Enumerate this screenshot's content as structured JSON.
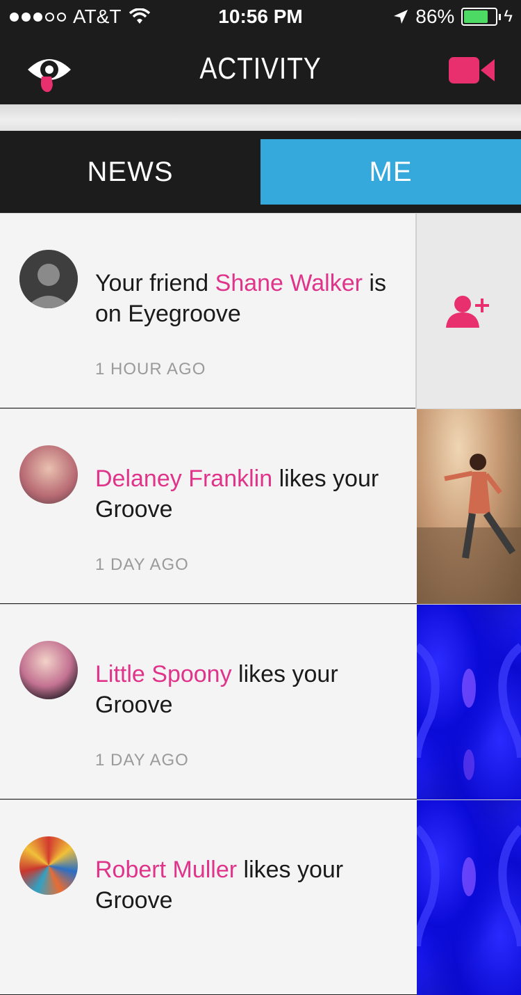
{
  "status_bar": {
    "carrier": "AT&T",
    "time": "10:56 PM",
    "battery_percent_label": "86%",
    "battery_level": 0.86,
    "signal_bars": 3
  },
  "nav": {
    "title": "ACTIVITY",
    "logo_icon": "eye-tongue-logo-icon",
    "video_icon": "video-camera-icon",
    "accent_color": "#e8306f"
  },
  "tabs": [
    {
      "label": "NEWS",
      "active": false
    },
    {
      "label": "ME",
      "active": true,
      "color": "#35a8dc"
    }
  ],
  "feed": [
    {
      "name": "Shane Walker",
      "prefix": "Your friend ",
      "suffix": " is on Eyegroove",
      "time": "1 HOUR AGO",
      "action": "add-friend-icon"
    },
    {
      "name": "Delaney Franklin",
      "prefix": "",
      "suffix": " likes your Groove",
      "time": "1 DAY AGO"
    },
    {
      "name": "Little Spoony",
      "prefix": "",
      "suffix": " likes your Groove",
      "time": "1 DAY AGO"
    },
    {
      "name": "Robert Muller",
      "prefix": "",
      "suffix": " likes your Groove",
      "time": ""
    }
  ]
}
